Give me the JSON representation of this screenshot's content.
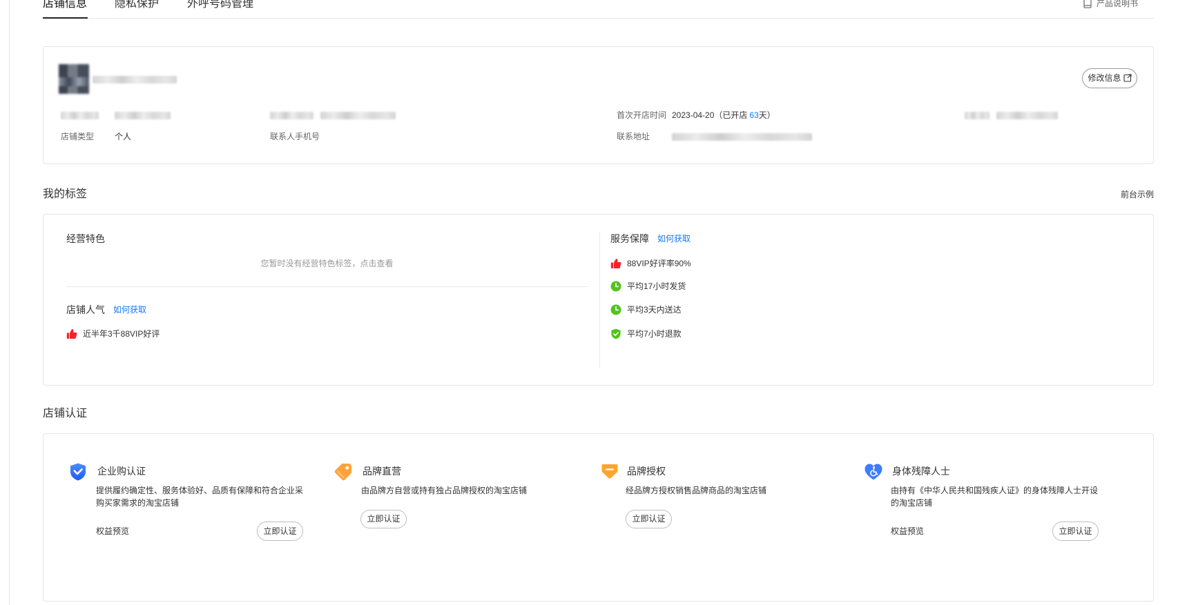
{
  "tabs": [
    {
      "label": "店铺信息",
      "active": true
    },
    {
      "label": "隐私保护",
      "active": false
    },
    {
      "label": "外呼号码管理",
      "active": false
    }
  ],
  "manual": {
    "label": "产品说明书",
    "icon": "document-icon"
  },
  "store_info": {
    "edit_button": "修改信息",
    "first_open": {
      "label": "首次开店时间",
      "date": "2023-04-20",
      "days_prefix": "（已开店",
      "days": "63",
      "days_suffix": "天）"
    },
    "store_type_label": "店铺类型",
    "store_type_value": "个人",
    "contact_phone_label": "联系人手机号",
    "address_label": "联系地址"
  },
  "tags": {
    "title": "我的标签",
    "preview_link": "前台示例",
    "feature": {
      "title": "经营特色",
      "empty_text": "您暂时没有经营特色标签，点击查看"
    },
    "popularity": {
      "title": "店铺人气",
      "how_link": "如何获取",
      "items": [
        {
          "icon": "thumbs-up-icon",
          "text": "近半年3千88VIP好评"
        }
      ]
    },
    "service": {
      "title": "服务保障",
      "how_link": "如何获取",
      "items": [
        {
          "icon": "thumbs-up-icon",
          "text": "88VIP好评率90%"
        },
        {
          "icon": "clock-icon",
          "text": "平均17小时发货"
        },
        {
          "icon": "clock-icon",
          "text": "平均3天内送达"
        },
        {
          "icon": "shield-check-icon",
          "text": "平均7小时退款"
        }
      ]
    }
  },
  "certification": {
    "title": "店铺认证",
    "items": [
      {
        "icon": "enterprise-shield-icon",
        "title": "企业购认证",
        "desc": [
          "提供履约确定性、服务体验好、品质有保障和符合企业采",
          "购买家需求的淘宝店铺"
        ],
        "benefit": "权益预览",
        "button": "立即认证"
      },
      {
        "icon": "brand-tag-icon",
        "title": "品牌直营",
        "desc": [
          "由品牌方自营或持有独占品牌授权的淘宝店铺"
        ],
        "button": "立即认证"
      },
      {
        "icon": "brand-badge-icon",
        "title": "品牌授权",
        "desc": [
          "经品牌方授权销售品牌商品的淘宝店铺"
        ],
        "button": "立即认证"
      },
      {
        "icon": "accessibility-heart-icon",
        "title": "身体残障人士",
        "desc": [
          "由持有《中华人民共和国残疾人证》的身体残障人士开设",
          "的淘宝店铺"
        ],
        "benefit": "权益预览",
        "button": "立即认证"
      }
    ]
  },
  "colors": {
    "link": "#1677ff",
    "thumb_red": "#f5222d",
    "service_green": "#52c41a",
    "enterprise_blue": "#2f6bff",
    "brand_orange": "#ffa23a",
    "border": "#e5e5e5"
  }
}
